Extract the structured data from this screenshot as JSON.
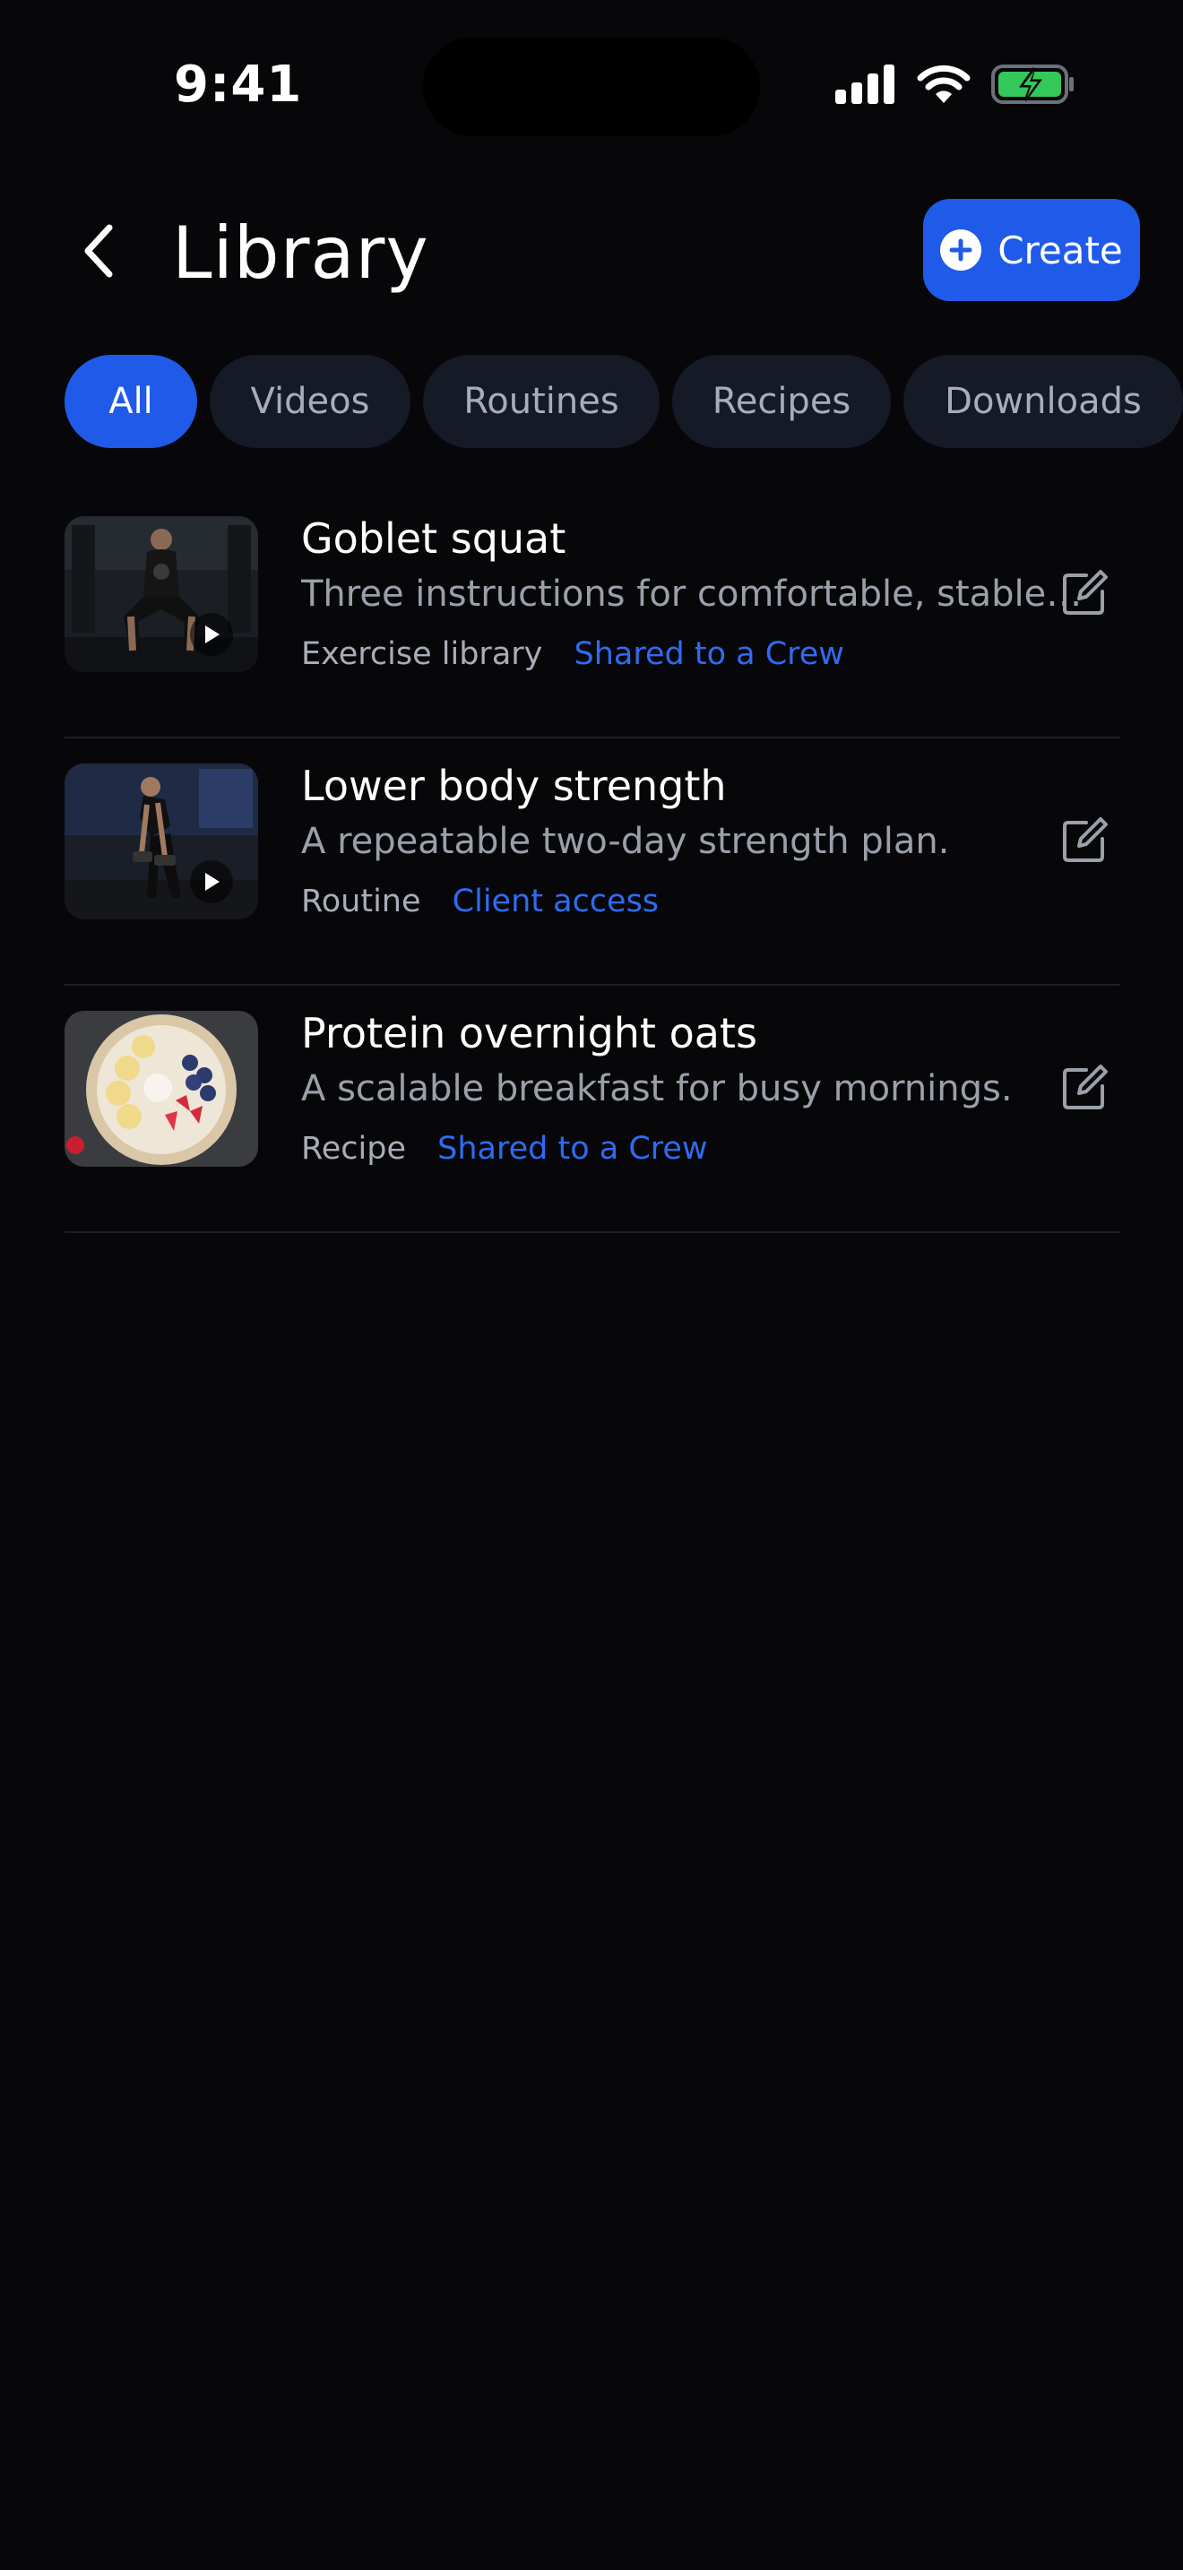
{
  "status_bar": {
    "time": "9:41"
  },
  "header": {
    "title": "Library",
    "create_label": "Create"
  },
  "filters": [
    "All",
    "Videos",
    "Routines",
    "Recipes",
    "Downloads"
  ],
  "active_filter": "All",
  "items": [
    {
      "title": "Goblet squat",
      "description": "Three instructions for comfortable, stable squats.",
      "kind": "Exercise library",
      "sharing": "Shared to a Crew",
      "media": "video"
    },
    {
      "title": "Lower body strength",
      "description": "A repeatable two-day strength plan.",
      "kind": "Routine",
      "sharing": "Client access",
      "media": "video"
    },
    {
      "title": "Protein overnight oats",
      "description": "A scalable breakfast for busy mornings.",
      "kind": "Recipe",
      "sharing": "Shared to a Crew",
      "media": "image"
    }
  ],
  "colors": {
    "background": "#07070a",
    "accent": "#1f5be8",
    "link": "#2f6bf2",
    "chip": "#151a26",
    "muted": "#9aa0aa"
  },
  "icons": [
    "back-chevron-icon",
    "plus-circle-icon",
    "play-icon",
    "edit-icon",
    "signal-icon",
    "wifi-icon",
    "battery-icon"
  ]
}
